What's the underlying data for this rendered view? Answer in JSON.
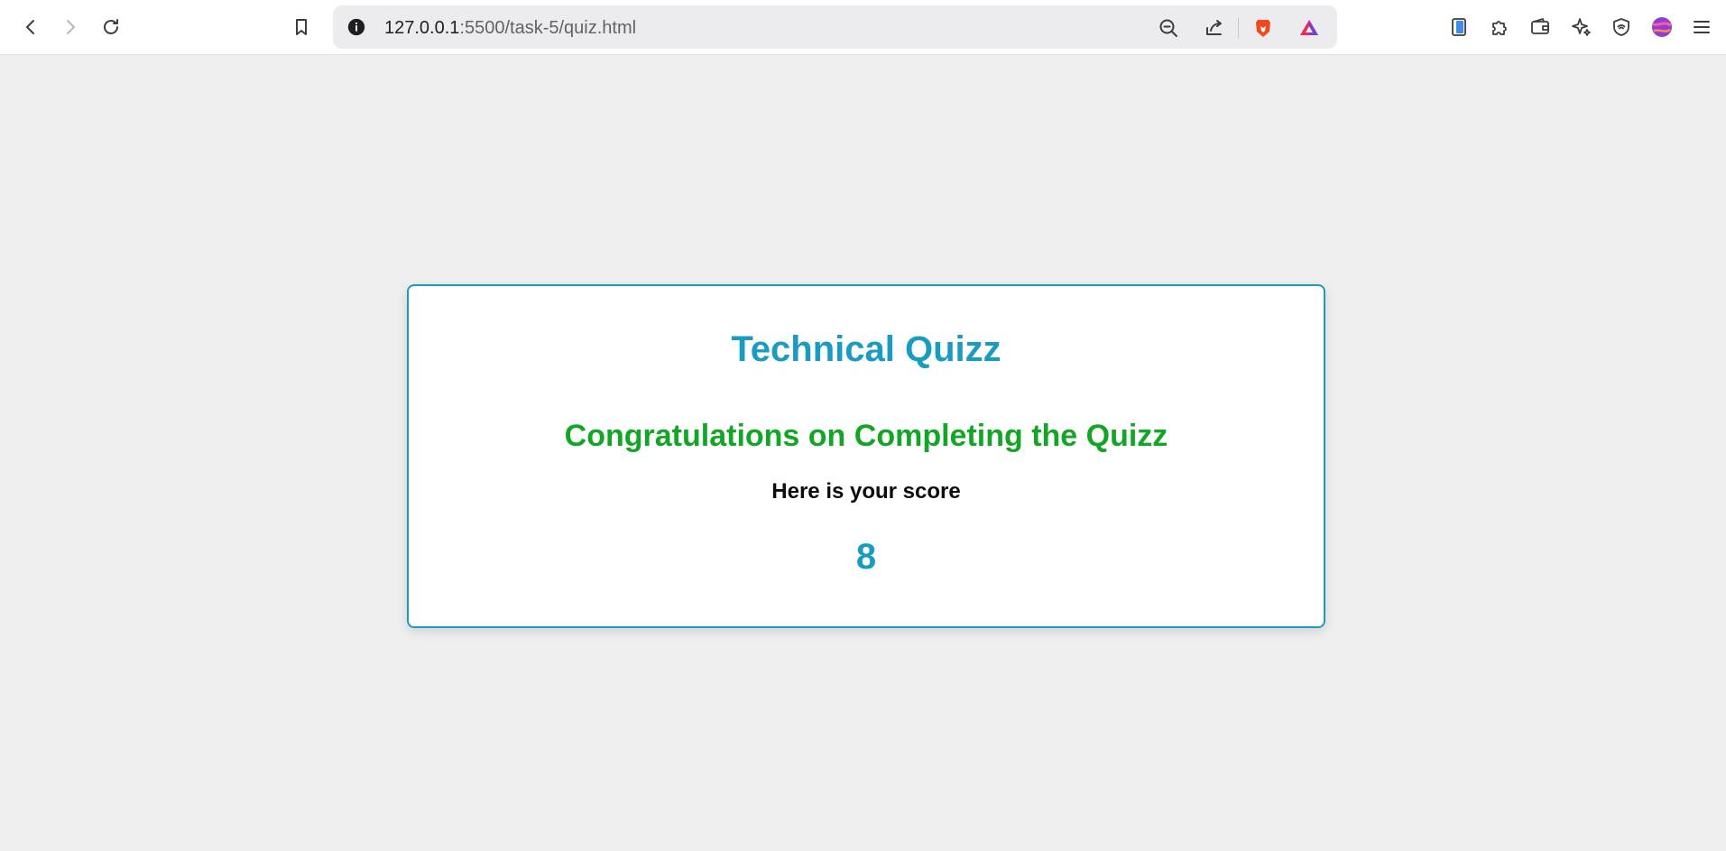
{
  "browser": {
    "url_host": "127.0.0.1",
    "url_rest": ":5500/task-5/quiz.html",
    "icons": {
      "back": "back-arrow-icon",
      "forward": "forward-arrow-icon",
      "reload": "reload-icon",
      "bookmark": "bookmark-icon",
      "site_info": "info-icon",
      "zoom": "zoom-out-icon",
      "share": "share-icon",
      "brave_shields": "brave-lion-icon",
      "rewards": "brave-rewards-icon",
      "sidebar": "sidebar-icon",
      "extensions": "puzzle-icon",
      "wallet": "wallet-icon",
      "leo": "leo-ai-icon",
      "vpn": "vpn-shield-icon",
      "profile": "profile-avatar-icon",
      "menu": "hamburger-menu-icon"
    }
  },
  "quiz": {
    "title": "Technical Quizz",
    "congrats": "Congratulations on Completing the Quizz",
    "score_label": "Here is your score",
    "score": "8"
  },
  "colors": {
    "accent": "#1a9bc2",
    "success": "#13a626",
    "page_bg": "#efefef"
  }
}
